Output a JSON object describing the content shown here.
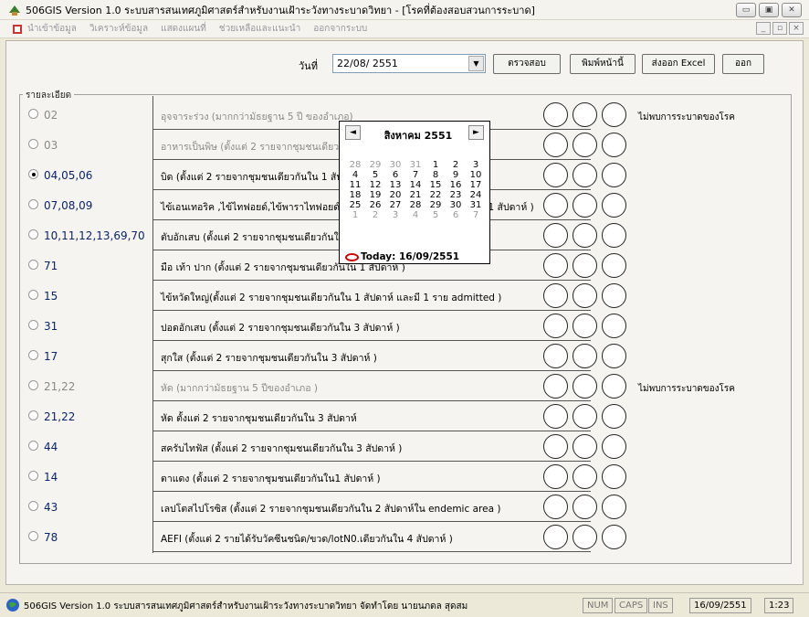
{
  "window": {
    "title": "506GIS Version 1.0 ระบบสารสนเทศภูมิศาสตร์สำหรับงานเฝ้าระวังทางระบาดวิทยา - [โรคที่ต้องสอบสวนการระบาด]",
    "btn_min": "▭",
    "btn_max": "▣",
    "btn_close": "✕"
  },
  "menu": {
    "items": [
      "นำเข้าข้อมูล",
      "วิเคราะห์ข้อมูล",
      "แสดงแผนที่",
      "ช่วยเหลือและแนะนำ",
      "ออกจากระบบ"
    ],
    "mdi_min": "_",
    "mdi_max": "▫",
    "mdi_close": "×"
  },
  "toolbar": {
    "date_label": "วันที่",
    "date_value": "22/08/ 2551",
    "check_label": "ตรวจสอบ",
    "print_label": "พิมพ์หน้านี้",
    "excel_label": "ส่งออก Excel",
    "exit_label": "ออก"
  },
  "detail": {
    "legend": "รายละเอียด",
    "rows": [
      {
        "code": "02",
        "desc": "อุจจาระร่วง (มากกว่ามัธยฐาน 5 ปี ของอำเภอ)",
        "dim": true,
        "selected": false,
        "note": "ไม่พบการระบาดของโรค"
      },
      {
        "code": "03",
        "desc": "อาหารเป็นพิษ (ตั้งแต่ 2 รายจากชุมชนเดียวกันใน 1 สัปดาห์)",
        "dim": true,
        "selected": false,
        "note": ""
      },
      {
        "code": "04,05,06",
        "desc": "บิด (ตั้งแต่ 2 รายจากชุมชนเดียวกันใน 1 สัปดาห์)",
        "dim": false,
        "selected": true,
        "note": ""
      },
      {
        "code": "07,08,09",
        "desc": "ไข้เอนเทอริค ,ไข้ไทฟอยด์,ไข้พาราไทฟอยด์ (ตั้งแต่ 2 รายจากชุมชนเดียวกันใน 1 สัปดาห์ )",
        "dim": false,
        "selected": false,
        "note": ""
      },
      {
        "code": "10,11,12,13,69,70",
        "desc": "ตับอักเสบ (ตั้งแต่ 2 รายจากชุมชนเดียวกันใน 1 สัปดาห์ )",
        "dim": false,
        "selected": false,
        "note": ""
      },
      {
        "code": "71",
        "desc": "มือ เท้า ปาก (ตั้งแต่ 2 รายจากชุมชนเดียวกันใน 1 สัปดาห์ )",
        "dim": false,
        "selected": false,
        "note": ""
      },
      {
        "code": "15",
        "desc": "ไข้หวัดใหญ่(ตั้งแต่ 2 รายจากชุมชนเดียวกันใน 1 สัปดาห์ และมี 1 ราย admitted )",
        "dim": false,
        "selected": false,
        "note": ""
      },
      {
        "code": "31",
        "desc": "ปอดอักเสบ (ตั้งแต่ 2 รายจากชุมชนเดียวกันใน 3 สัปดาห์ )",
        "dim": false,
        "selected": false,
        "note": ""
      },
      {
        "code": "17",
        "desc": "สุกใส (ตั้งแต่ 2 รายจากชุมชนเดียวกันใน 3 สัปดาห์ )",
        "dim": false,
        "selected": false,
        "note": ""
      },
      {
        "code": "21,22",
        "desc": "หัด (มากกว่ามัธยฐาน 5 ปีของอำเภอ )",
        "dim": true,
        "selected": false,
        "note": "ไม่พบการระบาดของโรค"
      },
      {
        "code": "21,22",
        "desc": "หัด ตั้งแต่ 2 รายจากชุมชนเดียวกันใน 3 สัปดาห์",
        "dim": false,
        "selected": false,
        "note": ""
      },
      {
        "code": "44",
        "desc": "สครับไทฟัส (ตั้งแต่ 2 รายจากชุมชนเดียวกันใน 3 สัปดาห์ )",
        "dim": false,
        "selected": false,
        "note": ""
      },
      {
        "code": "14",
        "desc": "ตาแดง (ตั้งแต่ 2 รายจากชุมชนเดียวกันใน1 สัปดาห์ )",
        "dim": false,
        "selected": false,
        "note": ""
      },
      {
        "code": "43",
        "desc": "เลปโตสไปโรซิส (ตั้งแต่ 2 รายจากชุมชนเดียวกันใน 2 สัปดาห์ใน endemic area )",
        "dim": false,
        "selected": false,
        "note": ""
      },
      {
        "code": "78",
        "desc": "AEFI (ตั้งแต่ 2 รายได้รับวัคซีนชนิด/ขวด/lotN0.เดียวกันใน 4 สัปดาห์ )",
        "dim": false,
        "selected": false,
        "note": ""
      }
    ]
  },
  "calendar": {
    "month": "สิงหาคม 2551",
    "prev": "◄",
    "next": "►",
    "weeks": [
      [
        [
          "28",
          1
        ],
        [
          "29",
          1
        ],
        [
          "30",
          1
        ],
        [
          "31",
          1
        ],
        [
          "1",
          0
        ],
        [
          "2",
          0
        ],
        [
          "3",
          0
        ]
      ],
      [
        [
          "4",
          0
        ],
        [
          "5",
          0
        ],
        [
          "6",
          0
        ],
        [
          "7",
          0
        ],
        [
          "8",
          0
        ],
        [
          "9",
          0
        ],
        [
          "10",
          0
        ]
      ],
      [
        [
          "11",
          0
        ],
        [
          "12",
          0
        ],
        [
          "13",
          0
        ],
        [
          "14",
          0
        ],
        [
          "15",
          0
        ],
        [
          "16",
          0
        ],
        [
          "17",
          0
        ]
      ],
      [
        [
          "18",
          0
        ],
        [
          "19",
          0
        ],
        [
          "20",
          0
        ],
        [
          "21",
          0
        ],
        [
          "22",
          0
        ],
        [
          "23",
          0
        ],
        [
          "24",
          0
        ]
      ],
      [
        [
          "25",
          0
        ],
        [
          "26",
          0
        ],
        [
          "27",
          0
        ],
        [
          "28",
          0
        ],
        [
          "29",
          0
        ],
        [
          "30",
          0
        ],
        [
          "31",
          0
        ]
      ],
      [
        [
          "1",
          1
        ],
        [
          "2",
          1
        ],
        [
          "3",
          1
        ],
        [
          "4",
          1
        ],
        [
          "5",
          1
        ],
        [
          "6",
          1
        ],
        [
          "7",
          1
        ]
      ]
    ],
    "today": "Today: 16/09/2551"
  },
  "statusbar": {
    "text": "506GIS Version 1.0 ระบบสารสนเทศภูมิศาสตร์สำหรับงานเฝ้าระวังทางระบาดวิทยา จัดทำโดย นายนภดล สุดสม",
    "num": "NUM",
    "caps": "CAPS",
    "ins": "INS",
    "date": "16/09/2551",
    "time": "1:23"
  }
}
